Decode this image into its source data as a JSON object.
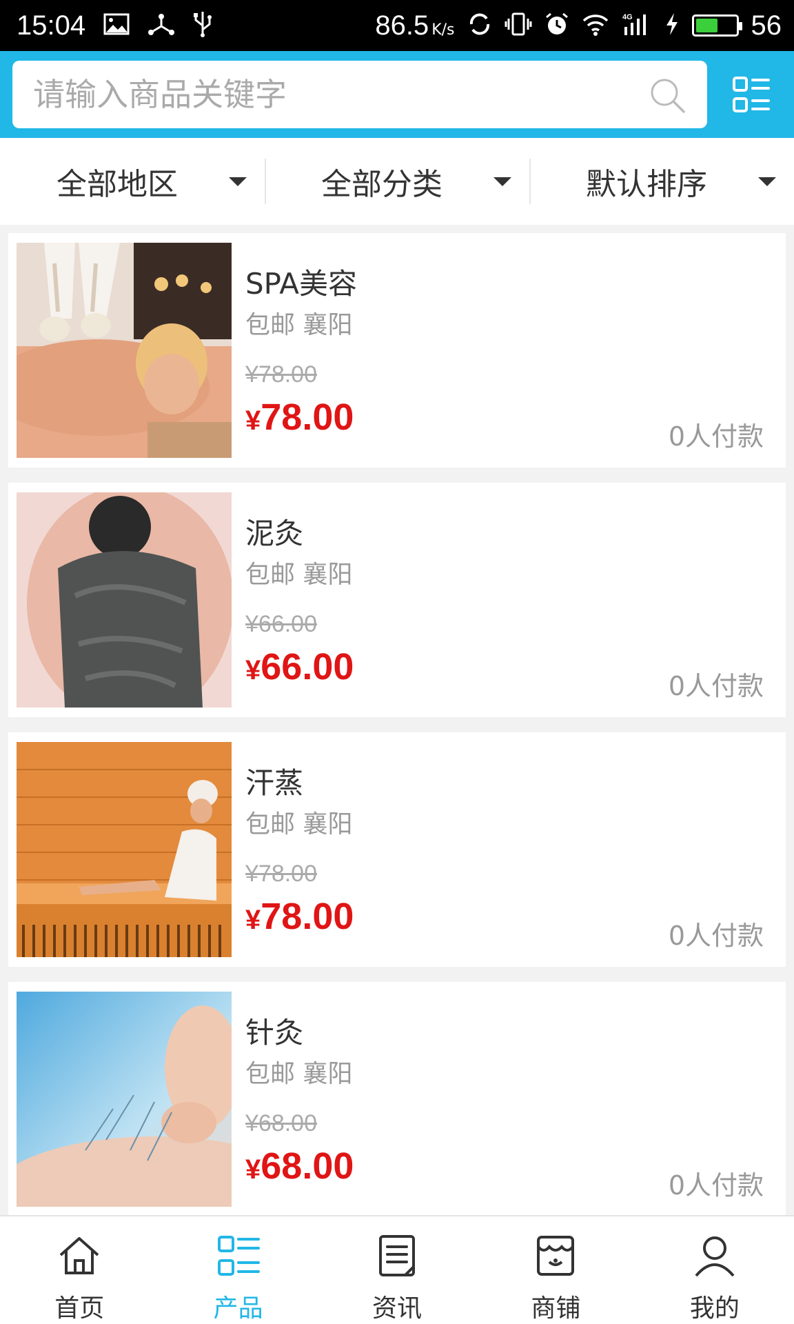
{
  "status_bar": {
    "time": "15:04",
    "network_speed": "86.5",
    "speed_unit": "K/s",
    "battery": "56",
    "battery_level": 0.56,
    "icons": [
      "image-icon",
      "usb-share-icon",
      "usb-icon",
      "sync-icon",
      "vibrate-icon",
      "alarm-icon",
      "wifi-icon",
      "4g-signal-icon",
      "charging-icon",
      "battery-icon"
    ]
  },
  "search": {
    "placeholder": "请输入商品关键字",
    "value": ""
  },
  "filters": [
    {
      "label": "全部地区"
    },
    {
      "label": "全部分类"
    },
    {
      "label": "默认排序"
    }
  ],
  "products": [
    {
      "title": "SPA美容",
      "meta": "包邮 襄阳",
      "old_price": "¥78.00",
      "currency": "¥",
      "price": "78.00",
      "sales": "0人付款"
    },
    {
      "title": "泥灸",
      "meta": "包邮 襄阳",
      "old_price": "¥66.00",
      "currency": "¥",
      "price": "66.00",
      "sales": "0人付款"
    },
    {
      "title": "汗蒸",
      "meta": "包邮 襄阳",
      "old_price": "¥78.00",
      "currency": "¥",
      "price": "78.00",
      "sales": "0人付款"
    },
    {
      "title": "针灸",
      "meta": "包邮 襄阳",
      "old_price": "¥68.00",
      "currency": "¥",
      "price": "68.00",
      "sales": "0人付款"
    }
  ],
  "nav": [
    {
      "label": "首页",
      "icon": "home-icon"
    },
    {
      "label": "产品",
      "icon": "grid-list-icon",
      "active": true
    },
    {
      "label": "资讯",
      "icon": "news-icon"
    },
    {
      "label": "商铺",
      "icon": "shop-icon"
    },
    {
      "label": "我的",
      "icon": "user-icon"
    }
  ],
  "colors": {
    "accent": "#21b7e6",
    "price_red": "#e01515",
    "muted": "#999999"
  }
}
